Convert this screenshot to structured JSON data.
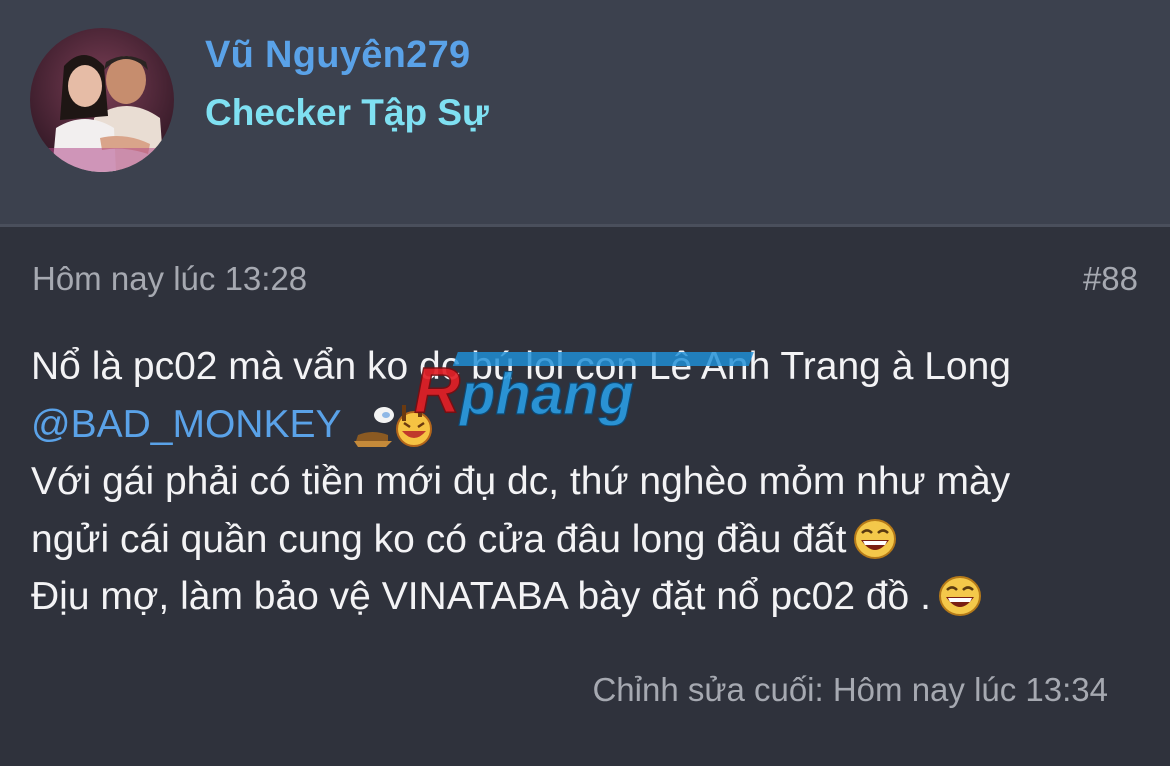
{
  "user": {
    "name": "Vũ Nguyên279",
    "title": "Checker Tập Sự"
  },
  "post": {
    "time": "Hôm nay lúc 13:28",
    "number": "#88",
    "lines": {
      "line1": "Nổ là pc02 mà vẩn ko dc bú lol con Lê Anh Trang à Long",
      "mention": "@BAD_MONKEY",
      "line3": "Với gái phải có tiền mới đụ dc, thứ nghèo mỏm như mày",
      "line4": "ngửi cái quần cung ko có cửa đâu long đầu đất",
      "line5": "Địu mợ, làm bảo vệ VINATABA bày đặt nổ pc02 đồ ."
    },
    "edited": "Chỉnh sửa cuối: Hôm nay lúc 13:34"
  },
  "watermark": {
    "text": "Rphang"
  },
  "icons": {
    "laugh": "laughing-smiley-icon",
    "sticker": "rolling-laugh-sticker-icon"
  },
  "colors": {
    "header_bg": "#3c414e",
    "page_bg": "#2f323c",
    "username": "#5aa2e8",
    "user_title": "#7fe0f2",
    "mention": "#5aa2e8",
    "muted_text": "#a6a9b1",
    "body_text": "#f3f3f5"
  }
}
